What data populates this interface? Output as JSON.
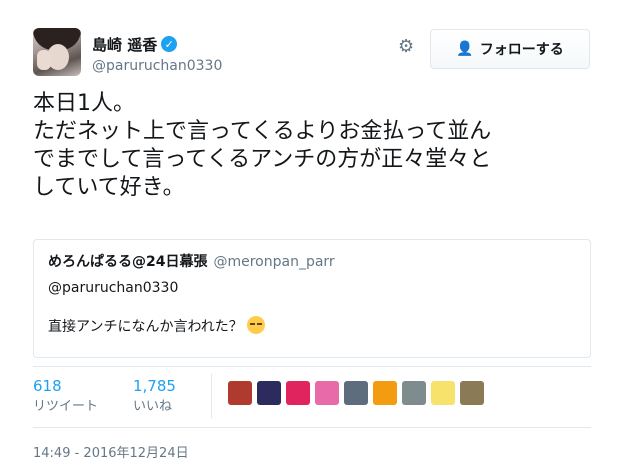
{
  "author": {
    "name": "島崎 遥香",
    "handle": "@paruruchan0330",
    "verified_icon": "check"
  },
  "follow_button": {
    "label": "フォローする",
    "icon": "add-user-icon"
  },
  "tweet_text": "本日1人。\nただネット上で言ってくるよりお金払って並ん\nでまでして言ってくるアンチの方が正々堂々と\nしていて好き。",
  "quote": {
    "name": "めろんぱるる@24日幕張",
    "handle": "@meronpan_parr",
    "reply_to": "@paruruchan0330",
    "text": "直接アンチになんか言われた？"
  },
  "stats": {
    "retweets": {
      "count": "618",
      "label": "リツイート"
    },
    "likes": {
      "count": "1,785",
      "label": "いいね"
    }
  },
  "likers": [
    {
      "color": "#b03a2e"
    },
    {
      "color": "#2b2b5e"
    },
    {
      "color": "#e0245e"
    },
    {
      "color": "#e86aa8"
    },
    {
      "color": "#5d6d7e"
    },
    {
      "color": "#f39c12"
    },
    {
      "color": "#7f8c8d"
    },
    {
      "color": "#f7e26b"
    },
    {
      "color": "#8a7a55"
    }
  ],
  "timestamp": "14:49 - 2016年12月24日",
  "colors": {
    "accent": "#1da1f2",
    "muted": "#657786",
    "border": "#e1e8ed"
  }
}
